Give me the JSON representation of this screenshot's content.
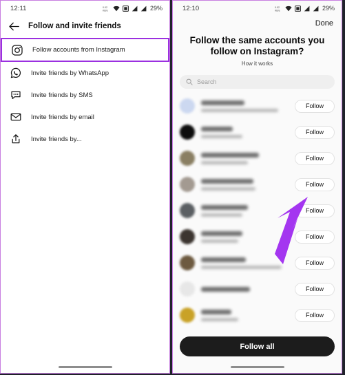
{
  "left_panel": {
    "status": {
      "time": "12:11",
      "battery": "29%",
      "icons": [
        "data-speed-icon",
        "wifi-icon",
        "sim-icon",
        "signal-icon",
        "signal-icon"
      ]
    },
    "appbar": {
      "back_icon": "back-arrow-icon",
      "title": "Follow and invite friends"
    },
    "menu_items": [
      {
        "label": "Follow accounts from Instagram",
        "icon": "instagram-icon",
        "highlighted": true
      },
      {
        "label": "Invite friends by WhatsApp",
        "icon": "whatsapp-icon",
        "highlighted": false
      },
      {
        "label": "Invite friends by SMS",
        "icon": "sms-bubble-icon",
        "highlighted": false
      },
      {
        "label": "Invite friends by email",
        "icon": "envelope-icon",
        "highlighted": false
      },
      {
        "label": "Invite friends by...",
        "icon": "share-icon",
        "highlighted": false
      }
    ]
  },
  "right_panel": {
    "status": {
      "time": "12:10",
      "battery": "29%"
    },
    "done_label": "Done",
    "title": "Follow the same accounts you follow on Instagram?",
    "subtitle": "How it works",
    "search": {
      "placeholder": "Search",
      "icon": "search-icon"
    },
    "accounts": [
      {
        "follow_label": "Follow",
        "avatar_color": "#ccd8f0",
        "name_width": "46%",
        "desc_width": "82%"
      },
      {
        "follow_label": "Follow",
        "avatar_color": "#0d0d0d",
        "name_width": "34%",
        "desc_width": "44%"
      },
      {
        "follow_label": "Follow",
        "avatar_color": "#8a7f63",
        "name_width": "62%",
        "desc_width": "50%"
      },
      {
        "follow_label": "Follow",
        "avatar_color": "#a39a91",
        "name_width": "56%",
        "desc_width": "58%"
      },
      {
        "follow_label": "Follow",
        "avatar_color": "#5b5f63",
        "name_width": "50%",
        "desc_width": "44%"
      },
      {
        "follow_label": "Follow",
        "avatar_color": "#3c3530",
        "name_width": "44%",
        "desc_width": "40%"
      },
      {
        "follow_label": "Follow",
        "avatar_color": "#6d5a40",
        "name_width": "48%",
        "desc_width": "86%"
      },
      {
        "follow_label": "Follow",
        "avatar_color": "#e7e7e7",
        "name_width": "52%",
        "desc_width": "0%"
      },
      {
        "follow_label": "Follow",
        "avatar_color": "#c9a227",
        "name_width": "32%",
        "desc_width": "40%"
      }
    ],
    "follow_all_label": "Follow all"
  },
  "annotation": {
    "arrow_color": "#a436f0",
    "target": "follow-button-row-4"
  }
}
